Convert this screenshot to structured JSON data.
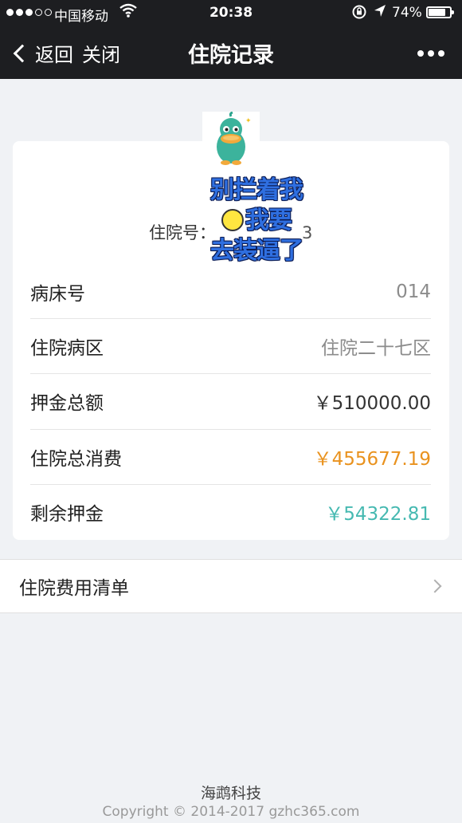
{
  "status_bar": {
    "carrier": "中国移动",
    "time": "20:38",
    "battery_text": "74%",
    "battery_level": 0.74
  },
  "nav": {
    "back_label": "返回",
    "close_label": "关闭",
    "title": "住院记录"
  },
  "sticker": {
    "line1": "别拦着我",
    "line2": "我要",
    "line3": "去装逼了"
  },
  "record": {
    "hospital_number_label": "住院号：",
    "hospital_number_value": "3",
    "rows": [
      {
        "label": "病床号",
        "value": "014"
      },
      {
        "label": "住院病区",
        "value": "住院二十七区"
      },
      {
        "label": "押金总额",
        "value": "￥510000.00"
      },
      {
        "label": "住院总消费",
        "value": "￥455677.19"
      },
      {
        "label": "剩余押金",
        "value": "￥54322.81"
      }
    ]
  },
  "colors": {
    "total_consumption": "#e9921e",
    "remaining_deposit": "#46b9b1"
  },
  "links": {
    "fee_list_label": "住院费用清单"
  },
  "footer": {
    "company": "海鹉科技",
    "copyright": "Copyright © 2014-2017 gzhc365.com"
  }
}
